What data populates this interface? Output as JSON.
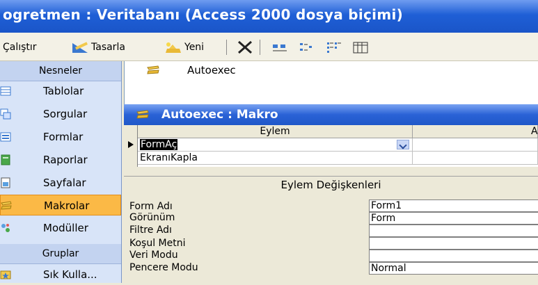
{
  "window": {
    "title": "ogretmen : Veritabanı (Access 2000 dosya biçimi)"
  },
  "toolbar": {
    "run_label": "Çalıştır",
    "design_label": "Tasarla",
    "design_accel": "T",
    "new_label": "Yeni",
    "new_accel": "n"
  },
  "objbar": {
    "objects_header": "Nesneler",
    "groups_header": "Gruplar",
    "items": [
      {
        "label": "Tablolar",
        "icon": "table-icon"
      },
      {
        "label": "Sorgular",
        "icon": "query-icon"
      },
      {
        "label": "Formlar",
        "icon": "form-icon"
      },
      {
        "label": "Raporlar",
        "icon": "report-icon"
      },
      {
        "label": "Sayfalar",
        "icon": "page-icon"
      },
      {
        "label": "Makrolar",
        "icon": "macro-icon",
        "selected": true
      },
      {
        "label": "Modüller",
        "icon": "module-icon"
      }
    ],
    "group_items": [
      {
        "label": "Sık Kulla...",
        "icon": "favorites-icon"
      }
    ]
  },
  "list": {
    "items": [
      {
        "label": "Autoexec",
        "icon": "macro-icon"
      }
    ]
  },
  "macro_window": {
    "title": "Autoexec : Makro",
    "columns": {
      "action": "Eylem",
      "comment": "Açıklama"
    },
    "rows": [
      {
        "action": "FormAç",
        "comment": ""
      },
      {
        "action": "EkranıKapla",
        "comment": ""
      }
    ],
    "params_header": "Eylem Değişkenleri",
    "params": [
      {
        "label": "Form Adı",
        "value": "Form1"
      },
      {
        "label": "Görünüm",
        "value": "Form"
      },
      {
        "label": "Filtre Adı",
        "value": ""
      },
      {
        "label": "Koşul Metni",
        "value": ""
      },
      {
        "label": "Veri Modu",
        "value": ""
      },
      {
        "label": "Pencere Modu",
        "value": "Normal"
      }
    ]
  },
  "colors": {
    "title_blue": "#1f5fd6",
    "selected_orange": "#fbb946",
    "objbar_blue": "#d8e4f8"
  }
}
